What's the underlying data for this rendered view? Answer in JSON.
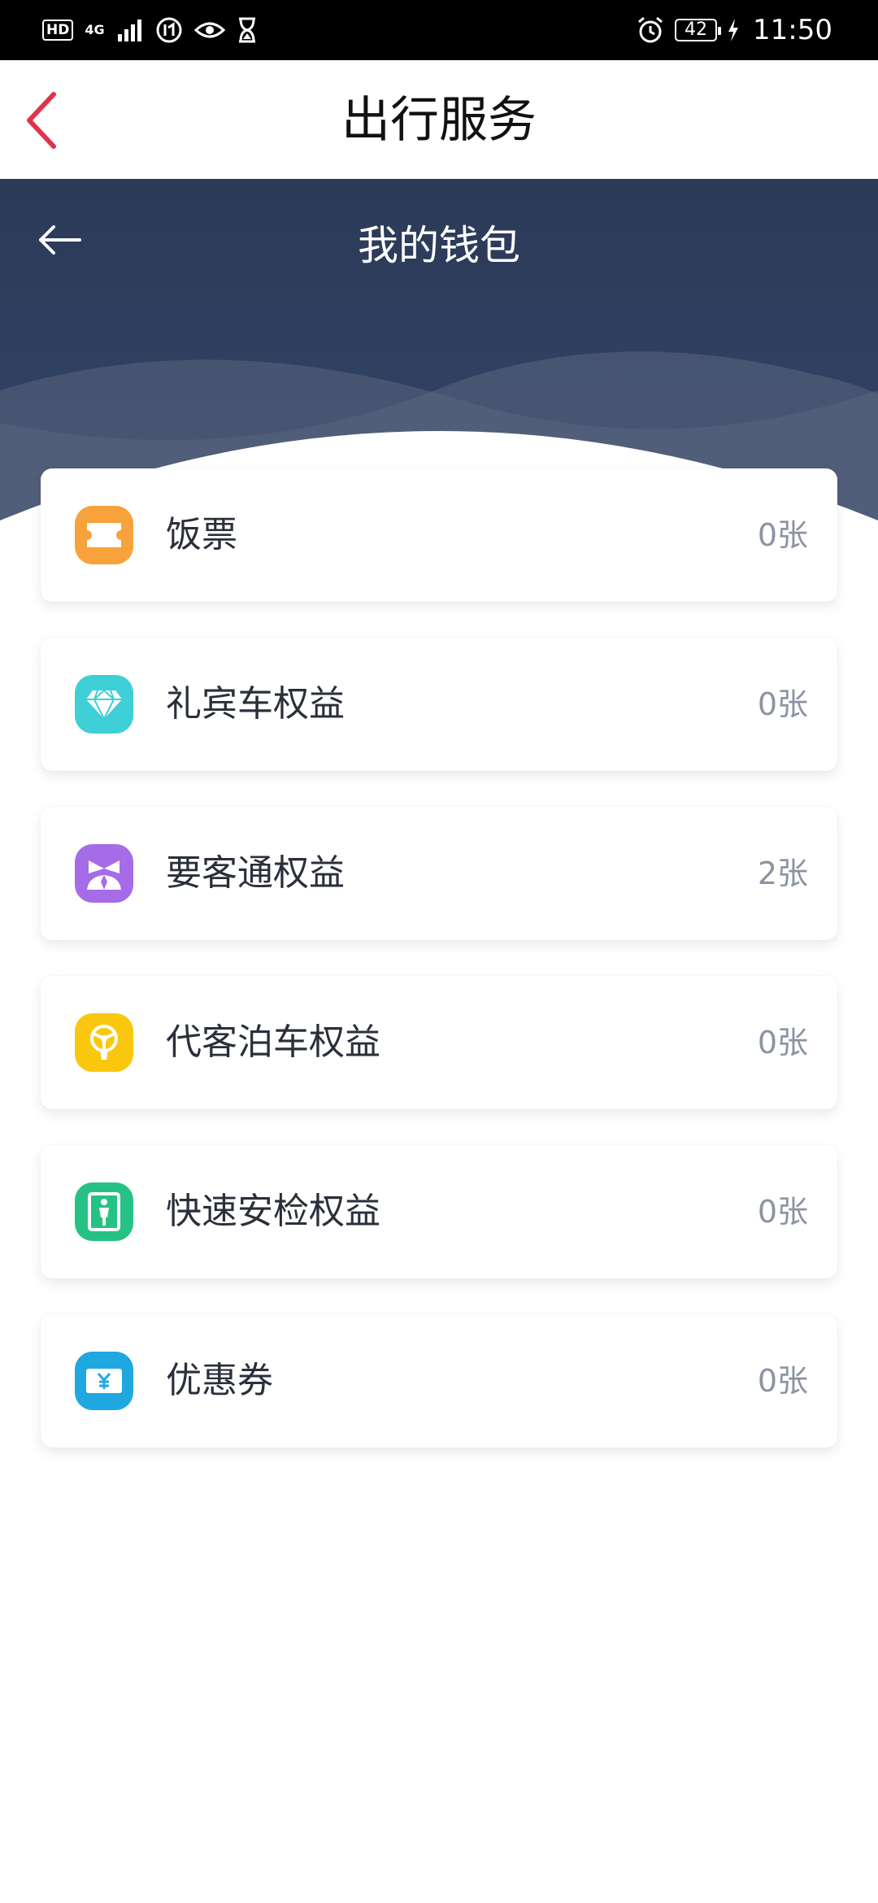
{
  "status_bar": {
    "hd": "HD",
    "network": "4G",
    "battery": "42",
    "time": "11:50"
  },
  "app_bar": {
    "title": "出行服务"
  },
  "wallet": {
    "title": "我的钱包"
  },
  "items": [
    {
      "label": "饭票",
      "count": "0张",
      "icon": "ticket-icon",
      "color": "#F7A23B"
    },
    {
      "label": "礼宾车权益",
      "count": "0张",
      "icon": "diamond-icon",
      "color": "#3FCFD6"
    },
    {
      "label": "要客通权益",
      "count": "2张",
      "icon": "vip-person-icon",
      "color": "#A66BE6"
    },
    {
      "label": "代客泊车权益",
      "count": "0张",
      "icon": "steering-wheel-icon",
      "color": "#F9C80E"
    },
    {
      "label": "快速安检权益",
      "count": "0张",
      "icon": "security-check-icon",
      "color": "#26C283"
    },
    {
      "label": "优惠券",
      "count": "0张",
      "icon": "coupon-icon",
      "color": "#1FA8E0"
    }
  ],
  "colors": {
    "accent_back": "#E0344B",
    "hero_dark": "#2B3A56",
    "hero_light": "#3B4A66"
  }
}
